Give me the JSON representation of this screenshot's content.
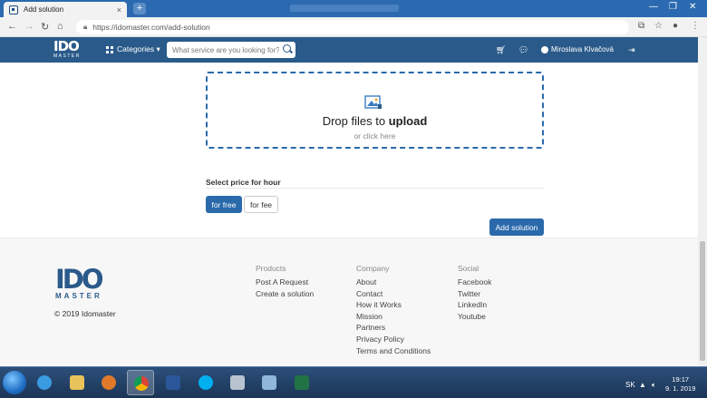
{
  "browser": {
    "tab_title": "Add solution",
    "tab_close": "×",
    "new_tab": "+",
    "url": "https://idomaster.com/add-solution",
    "window_controls": [
      "—",
      "❐",
      "✕"
    ]
  },
  "navbar": {
    "logo_top": "IDO",
    "logo_bottom": "MASTER",
    "categories_label": "Categories ▾",
    "search_placeholder": "What service are you looking for?",
    "user_name": "Miroslava Klvačová"
  },
  "upload": {
    "drop_text": "Drop files to ",
    "drop_bold": "upload",
    "sub_text": "or click here"
  },
  "price": {
    "heading": "Select price for hour",
    "free_label": "for free",
    "fee_label": "for fee"
  },
  "add_button": "Add solution",
  "footer": {
    "logo_top": "IDO",
    "logo_bottom": "MASTER",
    "copyright": "© 2019 Idomaster",
    "columns": [
      {
        "heading": "Products",
        "links": [
          "Post A Request",
          "Create a solution"
        ]
      },
      {
        "heading": "Company",
        "links": [
          "About",
          "Contact",
          "How it Works",
          "Mission",
          "Partners",
          "Privacy Policy",
          "Terms and Conditions"
        ]
      },
      {
        "heading": "Social",
        "links": [
          "Facebook",
          "Twitter",
          "LinkedIn",
          "Youtube"
        ]
      }
    ]
  },
  "taskbar": {
    "language": "SK",
    "time": "19:17",
    "date": "9. 1. 2019"
  },
  "colors": {
    "brand": "#2a5a8a",
    "accent": "#2a6aab"
  }
}
